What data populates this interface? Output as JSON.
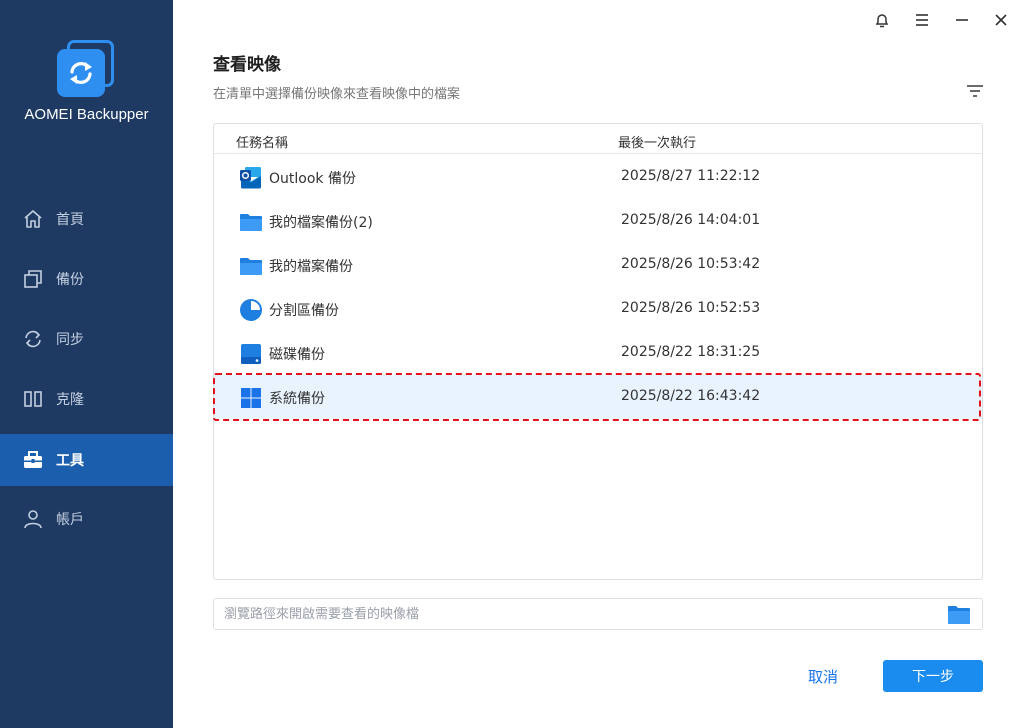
{
  "app": {
    "name": "AOMEI Backupper"
  },
  "sidebar": {
    "items": [
      {
        "label": "首頁",
        "icon": "home-icon"
      },
      {
        "label": "備份",
        "icon": "backup-icon"
      },
      {
        "label": "同步",
        "icon": "sync-icon"
      },
      {
        "label": "克隆",
        "icon": "clone-icon"
      },
      {
        "label": "工具",
        "icon": "toolbox-icon",
        "active": true
      },
      {
        "label": "帳戶",
        "icon": "user-icon"
      }
    ]
  },
  "page": {
    "title": "查看映像",
    "subtitle": "在清單中選擇備份映像來查看映像中的檔案"
  },
  "table": {
    "columns": [
      "任務名稱",
      "最後一次執行"
    ],
    "rows": [
      {
        "name": "Outlook 備份",
        "time": "2025/8/27 11:22:12",
        "icon": "outlook-icon"
      },
      {
        "name": "我的檔案備份(2)",
        "time": "2025/8/26 14:04:01",
        "icon": "folder-icon"
      },
      {
        "name": "我的檔案備份",
        "time": "2025/8/26 10:53:42",
        "icon": "folder-icon"
      },
      {
        "name": "分割區備份",
        "time": "2025/8/26 10:52:53",
        "icon": "partition-icon"
      },
      {
        "name": "磁碟備份",
        "time": "2025/8/22 18:31:25",
        "icon": "disk-icon"
      },
      {
        "name": "系統備份",
        "time": "2025/8/22 16:43:42",
        "icon": "windows-icon",
        "selected": true
      }
    ]
  },
  "browse": {
    "placeholder": "瀏覽路徑來開啟需要查看的映像檔",
    "value": ""
  },
  "buttons": {
    "cancel": "取消",
    "next": "下一步"
  },
  "colors": {
    "sidebar_bg": "#1e3a63",
    "active_nav": "#1b5eae",
    "accent": "#1a8cf0",
    "selection_outline": "#e0101c"
  }
}
